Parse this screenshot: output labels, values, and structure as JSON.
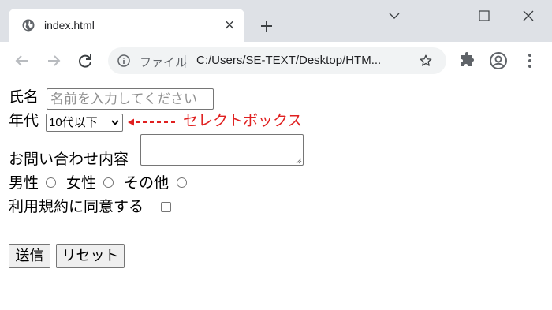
{
  "browser": {
    "tab_title": "index.html",
    "tab_close": "×",
    "omnibox_label": "ファイル",
    "omnibox_separator": "|",
    "url": "C:/Users/SE-TEXT/Desktop/HTM..."
  },
  "form": {
    "name_label": "氏名",
    "name_placeholder": "名前を入力してください",
    "age_label": "年代",
    "age_selected": "10代以下",
    "annotation_text": "セレクトボックス",
    "inquiry_label": "お問い合わせ内容",
    "gender_male": "男性",
    "gender_female": "女性",
    "gender_other": "その他",
    "terms_label": "利用規約に同意する",
    "submit_label": "送信",
    "reset_label": "リセット"
  },
  "colors": {
    "annotation": "#e02020",
    "chrome_bg": "#dee1e6"
  }
}
